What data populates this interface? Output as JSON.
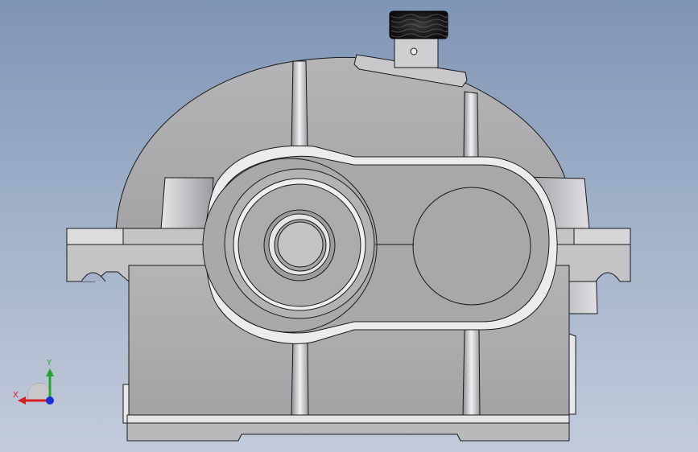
{
  "viewport": {
    "background_top": "#7f95b5",
    "background_bottom": "#c3cbda",
    "model_fill": "#a9a9ab",
    "model_light": "#d9d9dc",
    "model_dark": "#6f6f73",
    "edge_color": "#1a1a1a"
  },
  "triad": {
    "x_label": "X",
    "y_label": "Y",
    "x_color": "#d42020",
    "y_color": "#1fa82a",
    "z_color": "#1b2fd6"
  },
  "model": {
    "name_icon": "gear-reducer-housing-front-view",
    "components": [
      "upper-casing",
      "lower-casing",
      "input-bearing-cover",
      "output-bearing-cover",
      "breather-cap",
      "lifting-lugs",
      "base-plate"
    ]
  }
}
